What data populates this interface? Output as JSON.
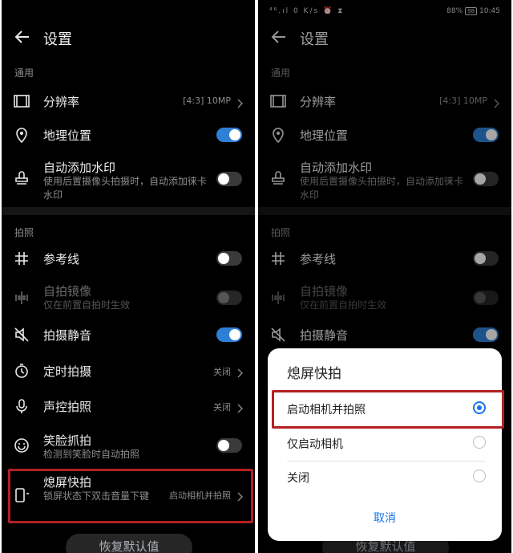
{
  "title": "设置",
  "status_bar": {
    "signal": "⁴⁶.ıl",
    "speed": "0 K/s",
    "battery": "88%",
    "battery_level": "98",
    "time": "10:45"
  },
  "sections": {
    "general": "通用",
    "photo": "拍照"
  },
  "items": {
    "resolution": {
      "label": "分辨率",
      "value": "[4:3] 10MP"
    },
    "location": {
      "label": "地理位置",
      "toggle": true
    },
    "watermark": {
      "label": "自动添加水印",
      "sub": "使用后置摄像头拍摄时，自动添加徕卡水印",
      "toggle": false
    },
    "gridlines": {
      "label": "参考线",
      "toggle": false
    },
    "mirror": {
      "label": "自拍镜像",
      "sub": "仅在前置自拍时生效",
      "toggle": false,
      "disabled": true
    },
    "mute": {
      "label": "拍摄静音",
      "toggle": true
    },
    "timer": {
      "label": "定时拍摄",
      "value": "关闭"
    },
    "voice": {
      "label": "声控拍照",
      "value": "关闭"
    },
    "smile": {
      "label": "笑脸抓拍",
      "sub": "检测到笑脸时自动拍照",
      "toggle": false
    },
    "ultra_snapshot": {
      "label": "熄屏快拍",
      "sub": "锁屏状态下双击音量下键",
      "value": "启动相机并拍照"
    }
  },
  "restore_button": "恢复默认值",
  "dialog": {
    "title": "熄屏快拍",
    "options": [
      {
        "label": "启动相机并拍照",
        "selected": true
      },
      {
        "label": "仅启动相机",
        "selected": false
      },
      {
        "label": "关闭",
        "selected": false
      }
    ],
    "cancel": "取消"
  },
  "colors": {
    "accent": "#2f7fd6",
    "highlight": "#b42121",
    "background": "#000000"
  }
}
